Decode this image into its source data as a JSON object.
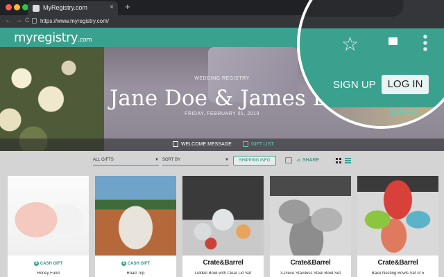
{
  "browser": {
    "tab_title": "MyRegistry.com",
    "tab_close": "×",
    "new_tab": "+",
    "url": "https://www.myregistry.com/",
    "nav_back": "←",
    "nav_forward": "→",
    "nav_reload": "C",
    "traffic_lights": [
      "#ff5f57",
      "#febc2e",
      "#28c840"
    ]
  },
  "site": {
    "logo": "myregistry",
    "logo_suffix": ".com",
    "brand_color": "#3aa18f"
  },
  "hero": {
    "subtitle": "WEDDING REGISTRY",
    "names": "Jane Doe & James Doe",
    "date": "FRIDAY, FEBRUARY 01, 2019",
    "tabs": [
      "WELCOME MESSAGE",
      "GIFT LIST"
    ]
  },
  "filters": {
    "category": "ALL GIFTS",
    "sort": "SORT BY",
    "shipping_button": "SHIPPING INFO",
    "share_label": "SHARE"
  },
  "products": [
    {
      "badge": "CASH GIFT",
      "title": "Honey Fund"
    },
    {
      "badge": "CASH GIFT",
      "title": "Road Trip"
    },
    {
      "brand": "Crate&Barrel",
      "title": "Lidded Bowl with Clear Lid Set"
    },
    {
      "brand": "Crate&Barrel",
      "title": "3-Piece Stainless Steel Bowl Set"
    },
    {
      "brand": "Crate&Barrel",
      "title": "Bake Nesting Bowls Set of 5"
    }
  ],
  "magnifier": {
    "sign_up": "SIGN UP",
    "log_in": "LOG IN",
    "language": "ESPAÑOL",
    "star_glyph": "☆"
  }
}
